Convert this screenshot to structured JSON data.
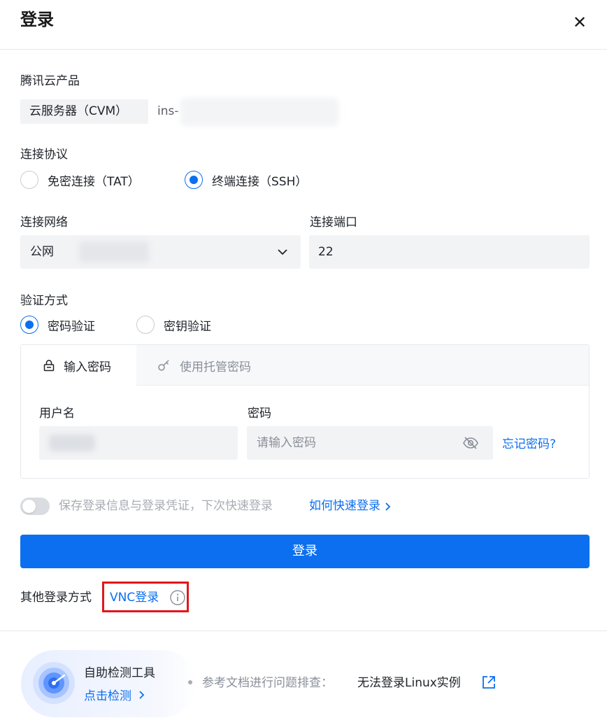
{
  "dialog": {
    "title": "登录",
    "close_icon": "close-icon"
  },
  "product": {
    "label": "腾讯云产品",
    "tag": "云服务器（CVM）",
    "instance_prefix": "ins-"
  },
  "protocol": {
    "label": "连接协议",
    "options": [
      {
        "label": "免密连接（TAT）",
        "selected": false
      },
      {
        "label": "终端连接（SSH）",
        "selected": true
      }
    ]
  },
  "network": {
    "label": "连接网络",
    "value_prefix": "公网",
    "icon": "chevron-down-icon"
  },
  "port": {
    "label": "连接端口",
    "value": "22"
  },
  "auth": {
    "label": "验证方式",
    "options": [
      {
        "label": "密码验证",
        "selected": true
      },
      {
        "label": "密钥验证",
        "selected": false
      }
    ],
    "tabs": [
      {
        "label": "输入密码",
        "icon": "lock-icon",
        "active": true
      },
      {
        "label": "使用托管密码",
        "icon": "key-icon",
        "active": false
      }
    ],
    "username_label": "用户名",
    "password_label": "密码",
    "password_placeholder": "请输入密码",
    "forgot_link": "忘记密码?"
  },
  "remember": {
    "text": "保存登录信息与登录凭证，下次快速登录",
    "link": "如何快速登录",
    "enabled": false
  },
  "submit_label": "登录",
  "other": {
    "label": "其他登录方式",
    "vnc_link": "VNC登录",
    "highlight_color": "#e2161c"
  },
  "footer": {
    "tool_title": "自助检测工具",
    "tool_link": "点击检测",
    "ref_text": "参考文档进行问题排查：",
    "ref_link": "无法登录Linux实例"
  },
  "colors": {
    "accent": "#0b6ff0",
    "field_bg": "#f2f3f5",
    "muted_text": "#8a8f99"
  }
}
